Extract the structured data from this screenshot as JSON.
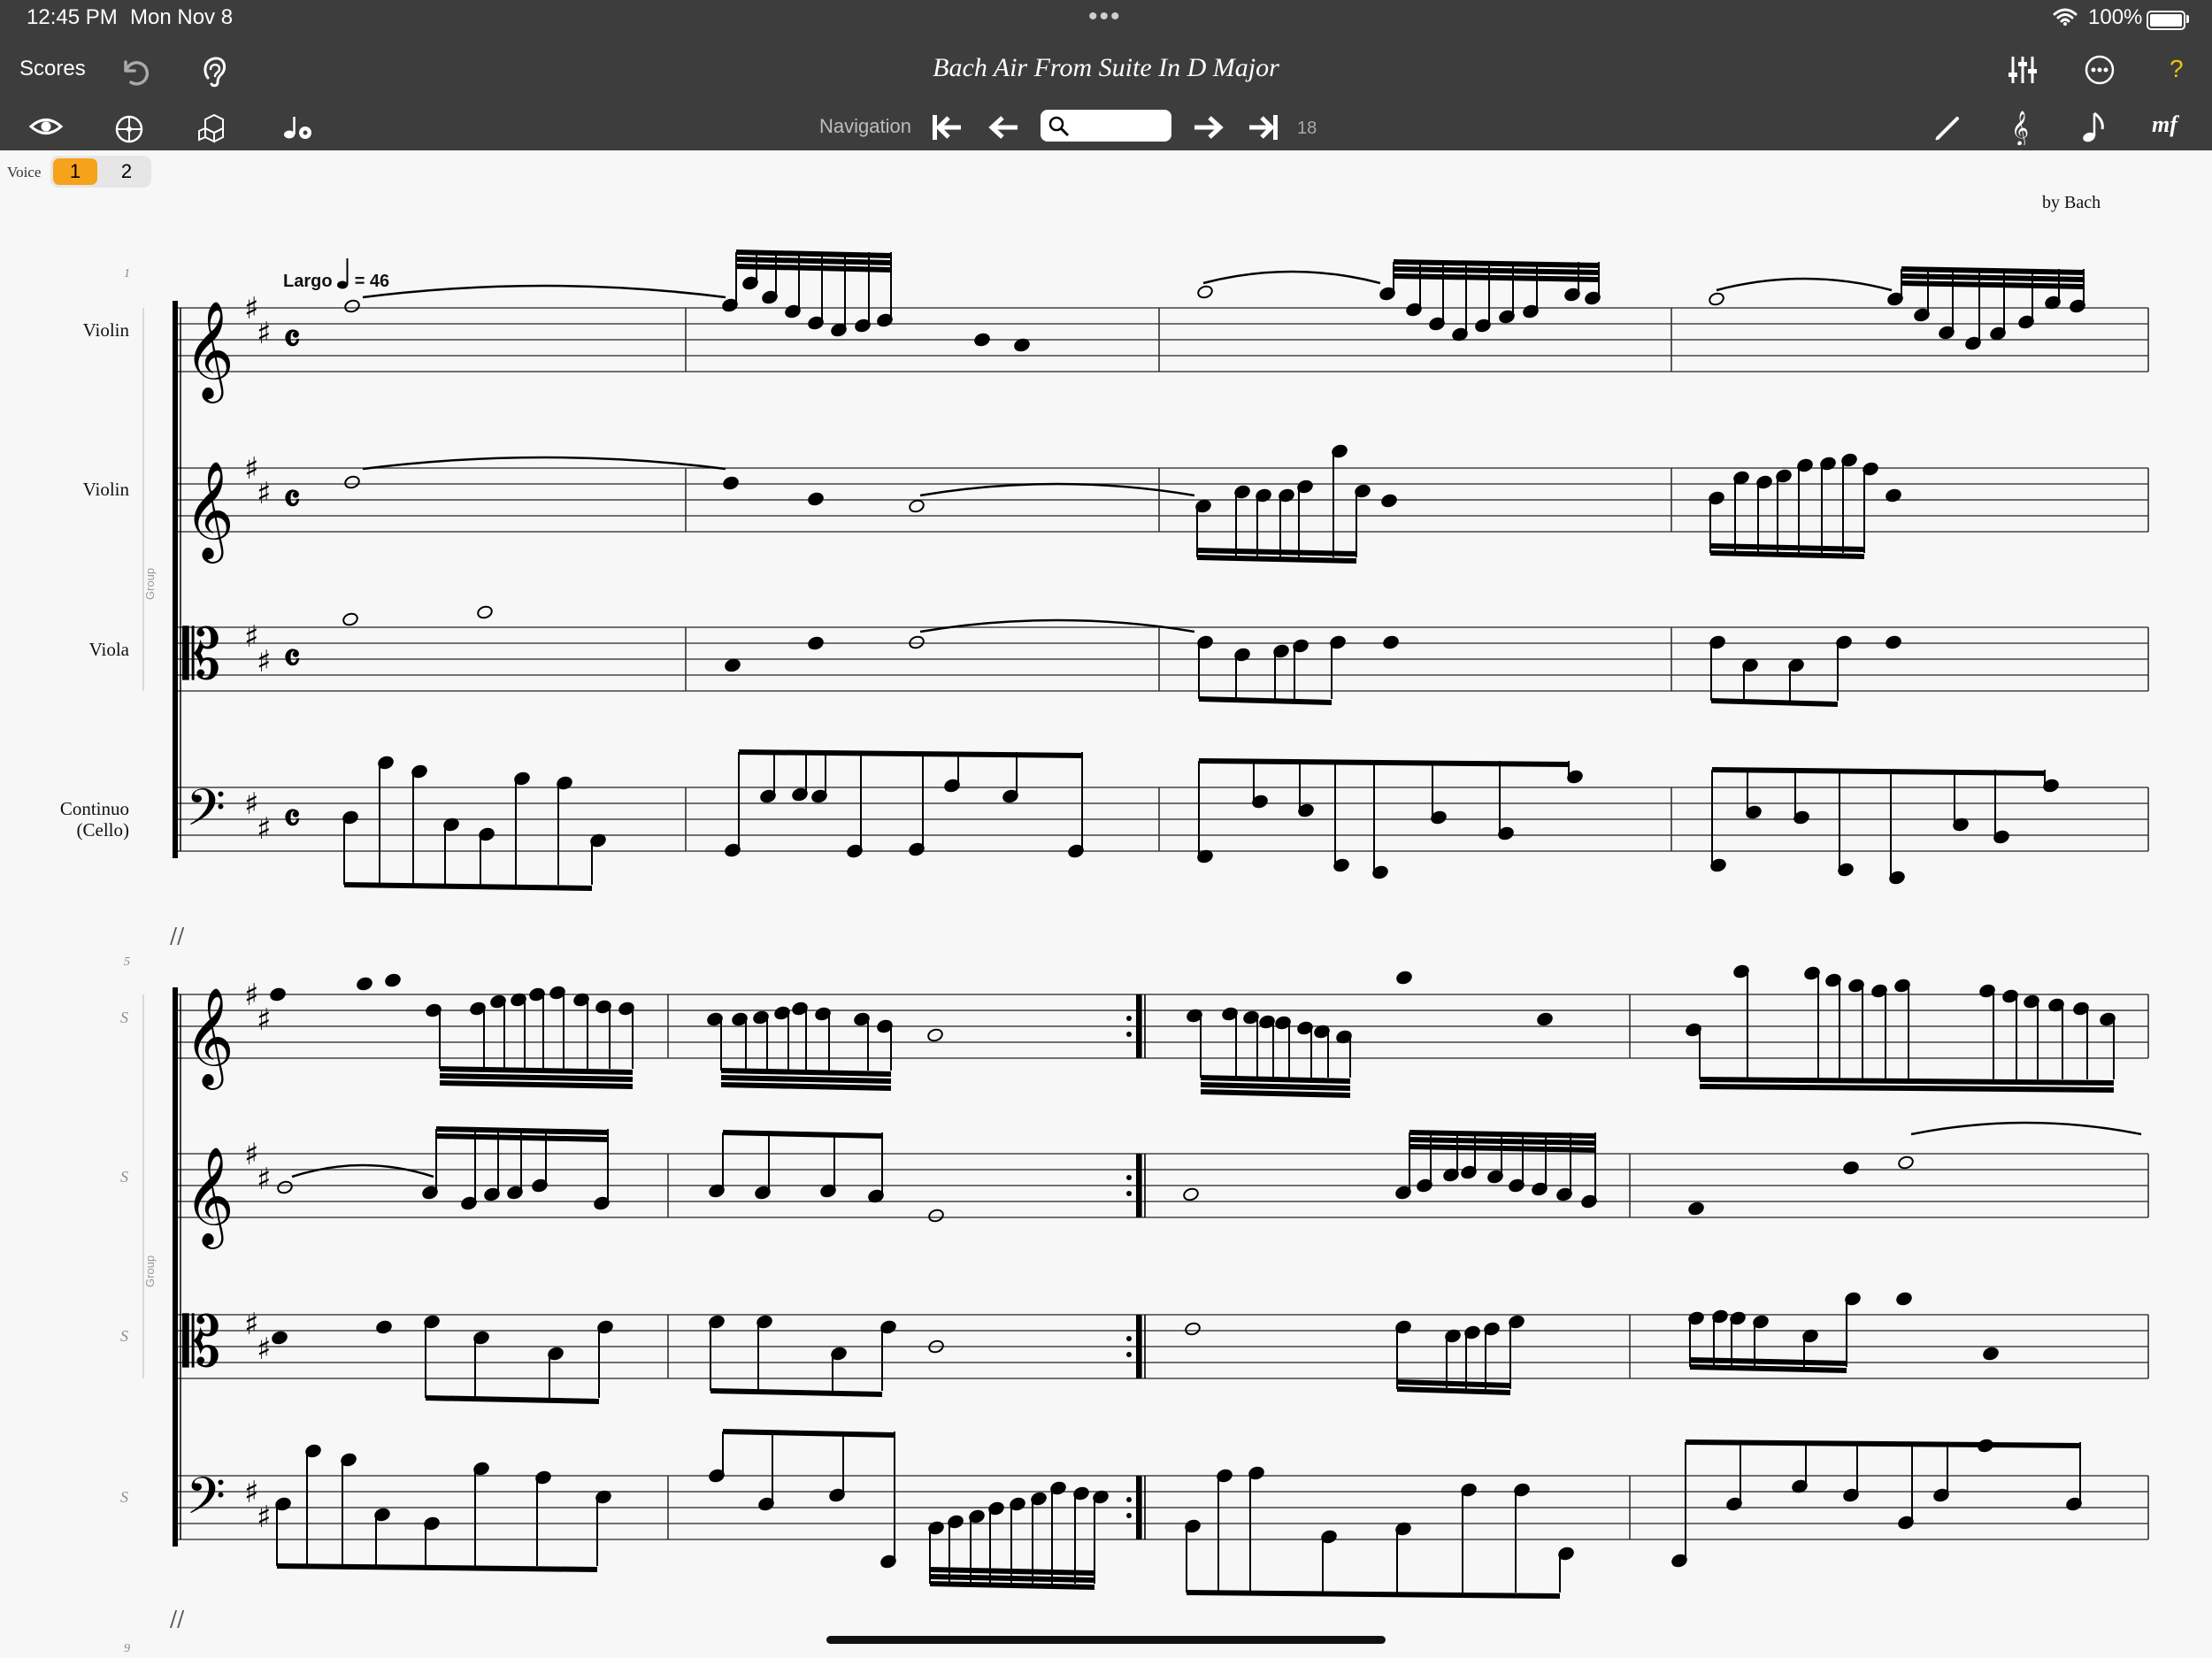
{
  "status_bar": {
    "time": "12:45 PM",
    "date": "Mon Nov 8",
    "battery": "100%"
  },
  "toolbar": {
    "scores_label": "Scores",
    "title": "Bach  Air From Suite In D Major",
    "help_label": "?",
    "navigation_label": "Navigation",
    "search_placeholder": "",
    "page_count": "18"
  },
  "voice": {
    "label": "Voice",
    "options": [
      "1",
      "2"
    ],
    "selected": "1"
  },
  "score": {
    "author": "by Bach",
    "tempo": {
      "text": "Largo",
      "bpm_text": "= 46"
    },
    "system1": {
      "bar_number": "1",
      "group_label": "Group",
      "instruments": [
        "Violin",
        "Violin",
        "Viola",
        "Continuo",
        "(Cello)"
      ]
    },
    "system2": {
      "bar_number": "5",
      "group_label": "Group",
      "instruments": [
        "S",
        "S",
        "S",
        "S"
      ]
    },
    "system3": {
      "bar_number": "9"
    }
  },
  "colors": {
    "toolbar": "#3d3d3d",
    "accent": "#f7a21b",
    "help": "#f5c400"
  }
}
